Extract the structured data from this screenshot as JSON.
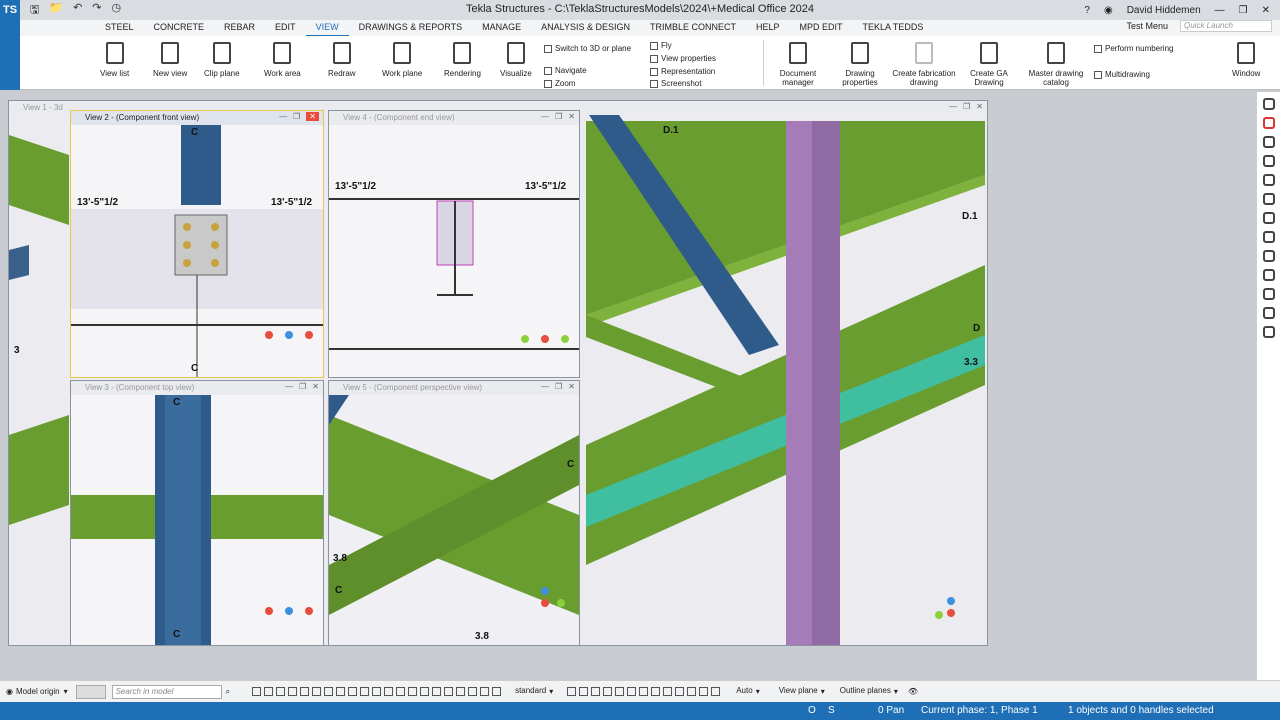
{
  "window": {
    "title": "Tekla Structures - C:\\TeklaStructuresModels\\2024\\+Medical Office 2024",
    "user": "David Hiddemen",
    "app_logo": "TS"
  },
  "menubar": {
    "items": [
      "STEEL",
      "CONCRETE",
      "REBAR",
      "EDIT",
      "VIEW",
      "DRAWINGS & REPORTS",
      "MANAGE",
      "ANALYSIS & DESIGN",
      "TRIMBLE CONNECT",
      "HELP",
      "MPD EDIT",
      "TEKLA TEDDS"
    ],
    "active": "VIEW",
    "test_menu": "Test Menu",
    "quick_launch_placeholder": "Quick Launch"
  },
  "ribbon": {
    "buttons": [
      {
        "label": "View list",
        "icon": "view-list-icon"
      },
      {
        "label": "New view",
        "icon": "new-view-icon"
      },
      {
        "label": "Clip plane",
        "icon": "clip-plane-icon"
      },
      {
        "label": "Work area",
        "icon": "work-area-icon"
      },
      {
        "label": "Redraw",
        "icon": "redraw-icon"
      },
      {
        "label": "Work plane",
        "icon": "work-plane-icon"
      },
      {
        "label": "Rendering",
        "icon": "rendering-icon"
      },
      {
        "label": "Visualize",
        "icon": "visualize-icon"
      }
    ],
    "small_group1": [
      "Switch to 3D or plane",
      "Navigate",
      "Zoom"
    ],
    "small_group2": [
      "Fly",
      "View properties",
      "Representation",
      "Screenshot"
    ],
    "drawing_buttons": [
      {
        "label": "Document manager",
        "icon": "document-manager-icon"
      },
      {
        "label": "Drawing properties",
        "icon": "drawing-properties-icon"
      },
      {
        "label": "Create fabrication drawing",
        "icon": "fabrication-drawing-icon"
      },
      {
        "label": "Create GA Drawing",
        "icon": "ga-drawing-icon"
      },
      {
        "label": "Master drawing catalog",
        "icon": "master-drawing-catalog-icon"
      }
    ],
    "numbering": [
      "Perform numbering",
      "Multidrawing"
    ],
    "window_label": "Window"
  },
  "views": {
    "view1": {
      "title": "View 1 - 3d"
    },
    "view2": {
      "title": "View 2 - (Component front view)",
      "dim_left": "13'-5\"1/2",
      "dim_right": "13'-5\"1/2",
      "grid_top": "C",
      "grid_bottom": "C"
    },
    "view4": {
      "title": "View 4 - (Component end view)",
      "dim_left": "13'-5\"1/2",
      "dim_right": "13'-5\"1/2"
    },
    "view3": {
      "title": "View 3 - (Component top view)",
      "grid_top": "C",
      "grid_bottom": "C"
    },
    "view5": {
      "title": "View 5 - (Component perspective view)",
      "label_c_top": "C",
      "label_c_left": "C",
      "label_38_left": "3.8",
      "label_38_bottom": "3.8"
    },
    "main3d": {
      "grid_d1_top": "D.1",
      "grid_d1_right": "D.1",
      "grid_d": "D",
      "grid_33": "3.3",
      "grid_3": "3"
    }
  },
  "bottom_bar": {
    "model_origin": "Model origin",
    "search_placeholder": "Search in model",
    "standard": "standard",
    "auto": "Auto",
    "view_plane": "View plane",
    "outline_planes": "Outline planes"
  },
  "status": {
    "o": "O",
    "s": "S",
    "pan": "0 Pan",
    "phase": "Current phase: 1, Phase 1",
    "selection": "1 objects and 0 handles selected"
  },
  "colors": {
    "brand": "#1e6fb5",
    "beam_green": "#6a9d2f",
    "column_blue": "#2f5b8a",
    "column_purple": "#a57cb8",
    "brace_teal": "#3fbfa0"
  }
}
